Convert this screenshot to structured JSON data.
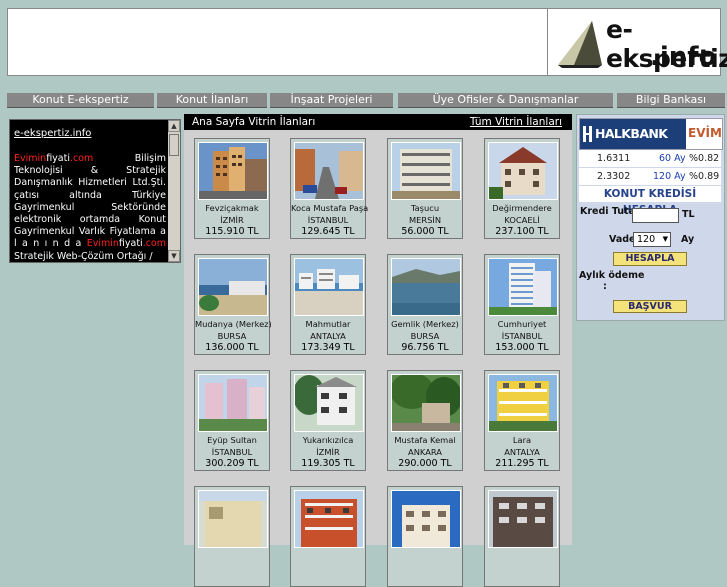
{
  "logo": {
    "line1": "e-ekspertiz",
    "line2": ".info"
  },
  "nav": [
    {
      "label": "Konut E-ekspertiz"
    },
    {
      "label": "Konut İlanları"
    },
    {
      "label": "İnşaat Projeleri"
    },
    {
      "label": "Üye Ofisler & Danışmanlar"
    },
    {
      "label": "Bilgi Bankası"
    }
  ],
  "sidebar": {
    "title": "e-ekspertiz.info",
    "brand_red": "Evimin",
    "brand_white": "fiyati",
    "brand_red2": ".com",
    "text_part1": " Bilişim Teknolojisi & Stratejik Danışmanlık Hizmetleri Ltd.Şti. çatısı altında Türkiye Gayrimenkul Sektöründe elektronik ortamda Konut Gayrimenkul Varlık Fiyatlama a l a n ı n d a ",
    "text_part2": " Stratejik Web-Çözüm Ortağı /"
  },
  "main": {
    "title": "Ana Sayfa Vitrin İlanları",
    "all_link": "Tüm Vitrin İlanları",
    "listings": [
      {
        "district": "Fevziçakmak",
        "city": "İZMİR",
        "price": "115.910 TL"
      },
      {
        "district": "Koca Mustafa Paşa",
        "city": "İSTANBUL",
        "price": "129.645 TL"
      },
      {
        "district": "Taşucu",
        "city": "MERSİN",
        "price": "56.000 TL"
      },
      {
        "district": "Değirmendere",
        "city": "KOCAELİ",
        "price": "237.100 TL"
      },
      {
        "district": "Mudanya (Merkez)",
        "city": "BURSA",
        "price": "136.000 TL"
      },
      {
        "district": "Mahmutlar",
        "city": "ANTALYA",
        "price": "173.349 TL"
      },
      {
        "district": "Gemlik (Merkez)",
        "city": "BURSA",
        "price": "96.756 TL"
      },
      {
        "district": "Cumhuriyet",
        "city": "İSTANBUL",
        "price": "153.000 TL"
      },
      {
        "district": "Eyüp Sultan",
        "city": "İSTANBUL",
        "price": "300.209 TL"
      },
      {
        "district": "Yukarıkızılca",
        "city": "İZMİR",
        "price": "119.305 TL"
      },
      {
        "district": "Mustafa Kemal",
        "city": "ANKARA",
        "price": "290.000 TL"
      },
      {
        "district": "Lara",
        "city": "ANTALYA",
        "price": "211.295 TL"
      },
      {
        "district": "",
        "city": "",
        "price": ""
      },
      {
        "district": "",
        "city": "",
        "price": ""
      },
      {
        "district": "",
        "city": "",
        "price": ""
      },
      {
        "district": "",
        "city": "",
        "price": ""
      }
    ]
  },
  "halkbank": {
    "brand": "HALKBANK",
    "sub": "EVİM",
    "rates": [
      {
        "factor": "1.6311",
        "months": "60 Ay",
        "rate": "%0.82"
      },
      {
        "factor": "2.3302",
        "months": "120 Ay",
        "rate": "%0.89"
      }
    ],
    "calc_title": "KONUT KREDİSİ HESAPLA",
    "amount_label": "Kredi Tutarı",
    "currency": "TL",
    "term_label": "Vade",
    "term_value": "120",
    "term_unit": "Ay",
    "calc_button": "HESAPLA",
    "payment_label": "Aylık ödeme",
    "payment_colon": ":",
    "apply_button": "BAŞVUR"
  },
  "colors": {
    "nav_bg": "#878787",
    "page_bg": "#b0c8c4",
    "halkbank_blue": "#1c3f7a"
  }
}
